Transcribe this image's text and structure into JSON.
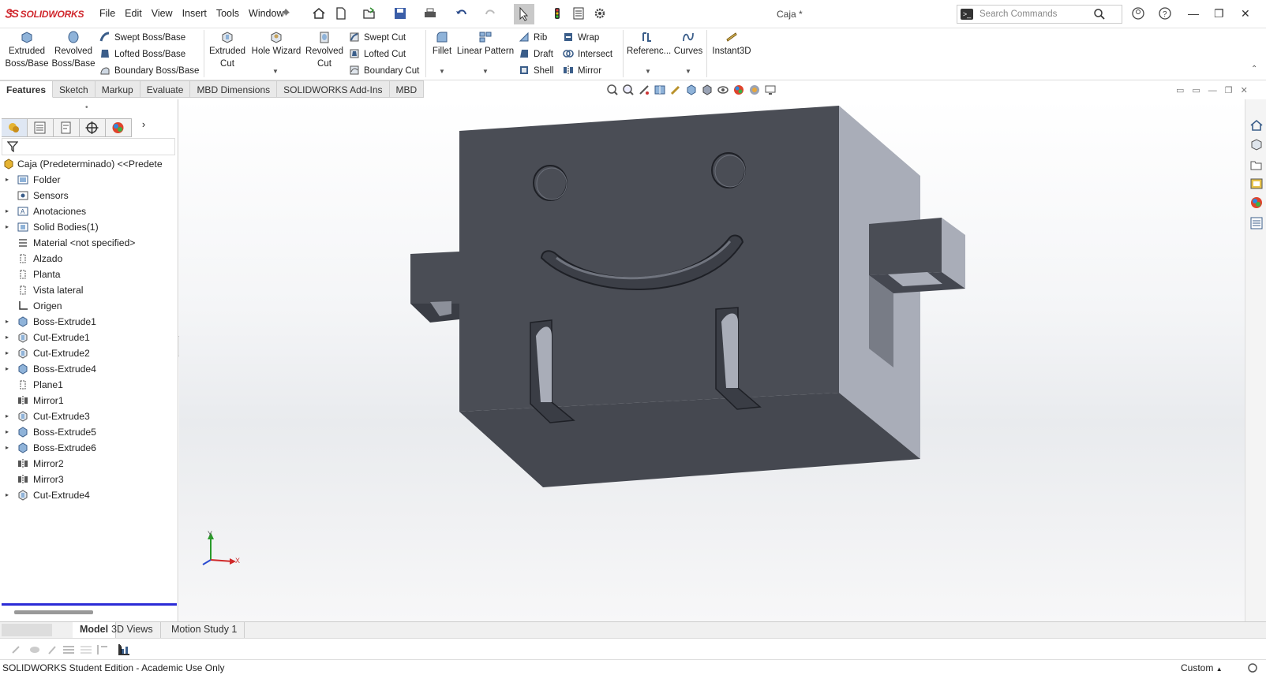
{
  "app": {
    "logo_text": "SOLIDWORKS",
    "document_title": "Caja *"
  },
  "menu": [
    "File",
    "Edit",
    "View",
    "Insert",
    "Tools",
    "Window"
  ],
  "search": {
    "placeholder": "Search Commands"
  },
  "commands": {
    "extruded_boss": "Extruded Boss/Base",
    "revolved_boss": "Revolved Boss/Base",
    "swept_boss": "Swept Boss/Base",
    "lofted_boss": "Lofted Boss/Base",
    "boundary_boss": "Boundary Boss/Base",
    "extruded_cut": "Extruded Cut",
    "hole_wizard": "Hole Wizard",
    "revolved_cut": "Revolved Cut",
    "swept_cut": "Swept Cut",
    "lofted_cut": "Lofted Cut",
    "boundary_cut": "Boundary Cut",
    "fillet": "Fillet",
    "linear_pattern": "Linear Pattern",
    "rib": "Rib",
    "draft": "Draft",
    "shell": "Shell",
    "wrap": "Wrap",
    "intersect": "Intersect",
    "mirror": "Mirror",
    "reference": "Referenc...",
    "curves": "Curves",
    "instant3d": "Instant3D"
  },
  "cmd_tabs": [
    "Features",
    "Sketch",
    "Markup",
    "Evaluate",
    "MBD Dimensions",
    "SOLIDWORKS Add-Ins",
    "MBD"
  ],
  "active_cmd_tab": "Features",
  "tree": [
    {
      "label": "Caja  (Predeterminado) <<Predete",
      "icon": "part-icon",
      "expandable": false,
      "root": true
    },
    {
      "label": "Folder",
      "icon": "folder-icon",
      "expandable": true
    },
    {
      "label": "Sensors",
      "icon": "sensor-icon",
      "expandable": false
    },
    {
      "label": "Anotaciones",
      "icon": "annotations-icon",
      "expandable": true
    },
    {
      "label": "Solid Bodies(1)",
      "icon": "solid-bodies-icon",
      "expandable": true
    },
    {
      "label": "Material <not specified>",
      "icon": "material-icon",
      "expandable": false
    },
    {
      "label": "Alzado",
      "icon": "plane-icon",
      "expandable": false
    },
    {
      "label": "Planta",
      "icon": "plane-icon",
      "expandable": false
    },
    {
      "label": "Vista lateral",
      "icon": "plane-icon",
      "expandable": false
    },
    {
      "label": "Origen",
      "icon": "origin-icon",
      "expandable": false
    },
    {
      "label": "Boss-Extrude1",
      "icon": "boss-extrude-icon",
      "expandable": true
    },
    {
      "label": "Cut-Extrude1",
      "icon": "cut-extrude-icon",
      "expandable": true
    },
    {
      "label": "Cut-Extrude2",
      "icon": "cut-extrude-icon",
      "expandable": true
    },
    {
      "label": "Boss-Extrude4",
      "icon": "boss-extrude-icon",
      "expandable": true
    },
    {
      "label": "Plane1",
      "icon": "plane-icon",
      "expandable": false
    },
    {
      "label": "Mirror1",
      "icon": "mirror-icon",
      "expandable": false
    },
    {
      "label": "Cut-Extrude3",
      "icon": "cut-extrude-icon",
      "expandable": true
    },
    {
      "label": "Boss-Extrude5",
      "icon": "boss-extrude-icon",
      "expandable": true
    },
    {
      "label": "Boss-Extrude6",
      "icon": "boss-extrude-icon",
      "expandable": true
    },
    {
      "label": "Mirror2",
      "icon": "mirror-icon",
      "expandable": false
    },
    {
      "label": "Mirror3",
      "icon": "mirror-icon",
      "expandable": false
    },
    {
      "label": "Cut-Extrude4",
      "icon": "cut-extrude-icon",
      "expandable": true
    }
  ],
  "triad": {
    "x": "X",
    "y": "Y"
  },
  "bottom_tabs": [
    "Model",
    "3D Views",
    "Motion Study 1"
  ],
  "active_bottom_tab": "Model",
  "status": {
    "text": "SOLIDWORKS Student Edition - Academic Use Only",
    "units": "Custom"
  },
  "colors": {
    "brand_red": "#d0282e",
    "rollback_bar": "#2b2bd6",
    "model_face_dark": "#4a4d55",
    "model_face_side": "#a9adb8"
  }
}
